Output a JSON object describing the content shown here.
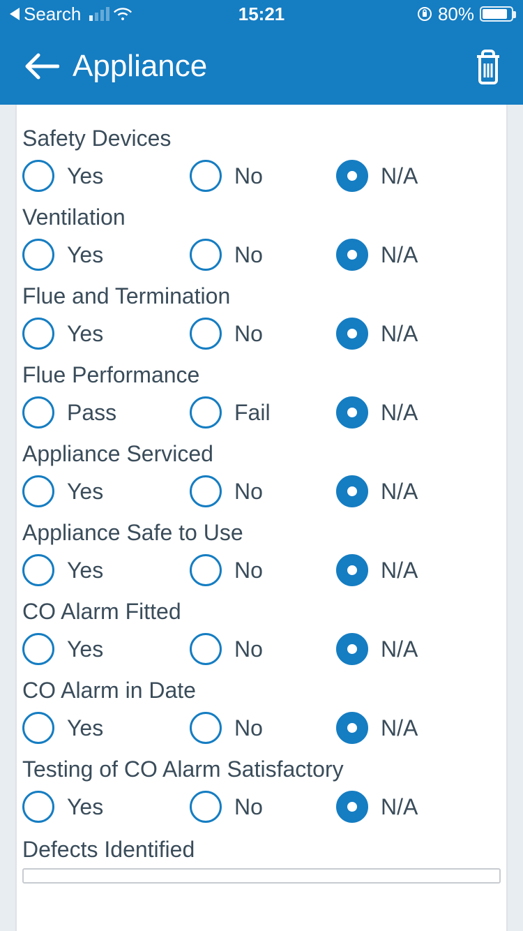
{
  "statusbar": {
    "back_label": "Search",
    "time": "15:21",
    "battery_pct": "80%"
  },
  "header": {
    "title": "Appliance"
  },
  "form": {
    "questions": [
      {
        "title": "Safety Devices",
        "options": [
          "Yes",
          "No",
          "N/A"
        ],
        "selected": 2
      },
      {
        "title": "Ventilation",
        "options": [
          "Yes",
          "No",
          "N/A"
        ],
        "selected": 2
      },
      {
        "title": "Flue and Termination",
        "options": [
          "Yes",
          "No",
          "N/A"
        ],
        "selected": 2
      },
      {
        "title": "Flue Performance",
        "options": [
          "Pass",
          "Fail",
          "N/A"
        ],
        "selected": 2
      },
      {
        "title": "Appliance Serviced",
        "options": [
          "Yes",
          "No",
          "N/A"
        ],
        "selected": 2
      },
      {
        "title": "Appliance Safe to Use",
        "options": [
          "Yes",
          "No",
          "N/A"
        ],
        "selected": 2
      },
      {
        "title": "CO Alarm Fitted",
        "options": [
          "Yes",
          "No",
          "N/A"
        ],
        "selected": 2
      },
      {
        "title": "CO Alarm in Date",
        "options": [
          "Yes",
          "No",
          "N/A"
        ],
        "selected": 2
      },
      {
        "title": "Testing of CO Alarm Satisfactory",
        "options": [
          "Yes",
          "No",
          "N/A"
        ],
        "selected": 2
      }
    ],
    "defects_label": "Defects Identified"
  }
}
